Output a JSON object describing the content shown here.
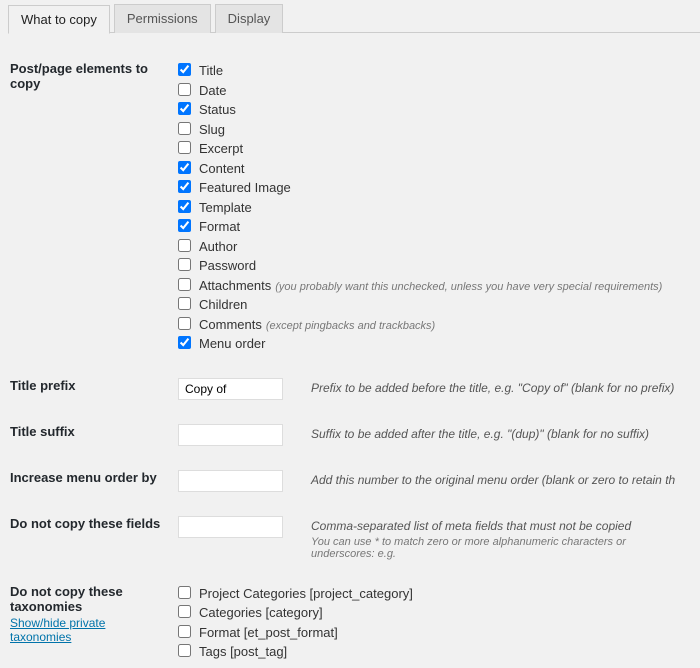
{
  "tabs": {
    "t0": "What to copy",
    "t1": "Permissions",
    "t2": "Display"
  },
  "rows": {
    "elements_label": "Post/page elements to copy",
    "title_prefix_label": "Title prefix",
    "title_suffix_label": "Title suffix",
    "increase_order_label": "Increase menu order by",
    "no_copy_fields_label": "Do not copy these fields",
    "no_copy_tax_label": "Do not copy these taxonomies",
    "tax_link": "Show/hide private taxonomies"
  },
  "checks": {
    "title": "Title",
    "date": "Date",
    "status": "Status",
    "slug": "Slug",
    "excerpt": "Excerpt",
    "content": "Content",
    "featured": "Featured Image",
    "template": "Template",
    "format": "Format",
    "author": "Author",
    "password": "Password",
    "attachments": "Attachments",
    "attachments_hint": "(you probably want this unchecked, unless you have very special requirements)",
    "children": "Children",
    "comments": "Comments",
    "comments_hint": "(except pingbacks and trackbacks)",
    "menu_order": "Menu order"
  },
  "inputs": {
    "title_prefix_value": "Copy of",
    "title_suffix_value": "",
    "increase_order_value": "",
    "no_copy_fields_value": ""
  },
  "desc": {
    "title_prefix": "Prefix to be added before the title, e.g. \"Copy of\" (blank for no prefix)",
    "title_suffix": "Suffix to be added after the title, e.g. \"(dup)\" (blank for no suffix)",
    "increase_order": "Add this number to the original menu order (blank or zero to retain th",
    "no_copy_fields": "Comma-separated list of meta fields that must not be copied",
    "no_copy_fields_sub": "You can use * to match zero or more alphanumeric characters or underscores: e.g. "
  },
  "tax": {
    "t0": "Project Categories [project_category]",
    "t1": "Categories [category]",
    "t2": "Format [et_post_format]",
    "t3": "Tags [post_tag]"
  }
}
